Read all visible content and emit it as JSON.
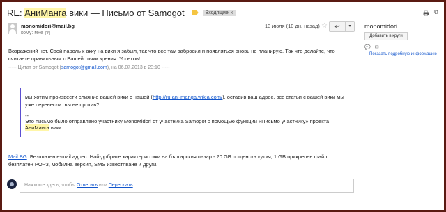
{
  "header": {
    "subject_prefix": "RE: ",
    "subject_highlight": "АниМанга",
    "subject_rest": " вики — Письмо от Samogot",
    "inbox_label": "Входящие",
    "inbox_close": "x",
    "print_icon": "print-icon",
    "popout_icon": "new-window-icon"
  },
  "message": {
    "from": "monomidori@mail.bg",
    "to_label": "кому: мне",
    "date": "13 июля (10 дн. назад)",
    "body_p1": "Возражений нет. Свой пароль к акку на вики я забыл, так что все там забросил и появляться вновь не планирую. Так что делайте, что считаете правильным с Вашей точки зрения. Успехов!",
    "quote_head_pre": "----- Цитат от Samogot (",
    "quote_head_email": "samogot@gmail.com",
    "quote_head_post": "), на 06.07.2013 в 23:10 -----",
    "quote_p1_pre": "мы хотим произвести слияние вашей вики с нашей (",
    "quote_p1_link": "http://ru.ani-manga.wikia.com/",
    "quote_p1_post": "), оставив ваш адрес. все статьи с вашей вики мы уже перенесли. вы не против?",
    "quote_dash": "--",
    "quote_p2_pre": "Это письмо было отправлено участнику MonoMidori от участника Samogot с помощью функции «Письмо участнику» проекта ",
    "quote_p2_hl": "АниМанга",
    "quote_p2_post": " вики.",
    "sig_line": "_______________________________",
    "sig_link": "Mail.BG",
    "sig_text": ": Безплатен e-mail адрес. Най-добрите характеристики на българския пазар - 20 GB пощенска кутия, 1 GB прикрепен файл, безплатен POP3, мобилна версия, SMS известяване и други."
  },
  "reply": {
    "prefix": "Нажмите здесь, чтобы ",
    "reply_link": "Ответить",
    "or": " или ",
    "forward_link": "Переслать"
  },
  "sidebar": {
    "name": "monomidori",
    "add_circles": "Добавить в круги",
    "details_link": "Показать подробную информацию"
  }
}
